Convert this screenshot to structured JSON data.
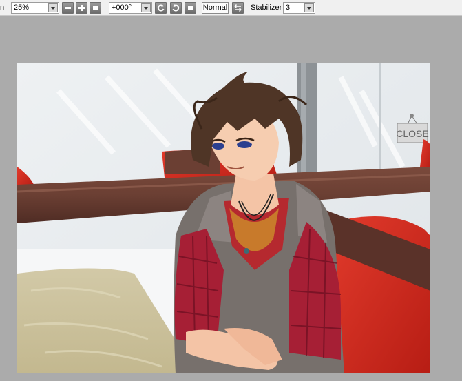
{
  "toolbar": {
    "zoom_label_fragment": "n",
    "zoom_value": "25%",
    "rotation_value": "+000°",
    "blend_mode_label": "Normal",
    "stabilizer_label": "Stabilizer",
    "stabilizer_value": "3"
  },
  "canvas": {
    "sign_text": "CLOSE"
  },
  "colors": {
    "toolbar_bg": "#f0f0f0",
    "workspace_bg": "#ababab",
    "icon_button": "#7c7c7c"
  }
}
